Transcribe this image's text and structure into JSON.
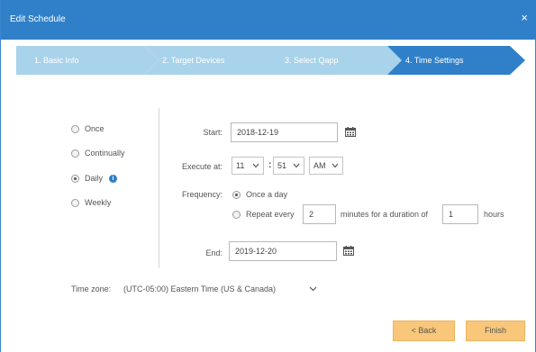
{
  "dialog": {
    "title": "Edit Schedule",
    "close_glyph": "×"
  },
  "steps": [
    {
      "label": "1. Basic Info",
      "state": "completed"
    },
    {
      "label": "2. Target Devices",
      "state": "completed"
    },
    {
      "label": "3. Select Qapp",
      "state": "completed"
    },
    {
      "label": "4. Time Settings",
      "state": "active"
    }
  ],
  "schedule_types": [
    {
      "label": "Once",
      "checked": false
    },
    {
      "label": "Continually",
      "checked": false
    },
    {
      "label": "Daily",
      "checked": true,
      "info": "i"
    },
    {
      "label": "Weekly",
      "checked": false
    }
  ],
  "start": {
    "label": "Start:",
    "value": "2018-12-19"
  },
  "execute_at": {
    "label": "Execute at:",
    "hour": "11",
    "minute": "51",
    "separator": ":",
    "ampm": "AM"
  },
  "frequency": {
    "label": "Frequency:",
    "once_a_day": "Once a day",
    "repeat_every": "Repeat every",
    "repeat_minutes": "2",
    "minutes_text": "minutes for a duration of",
    "duration": "1",
    "hours_text": "hours",
    "selected": "once_a_day"
  },
  "end": {
    "label": "End:",
    "value": "2019-12-20"
  },
  "timezone": {
    "label": "Time zone:",
    "value": "(UTC-05:00) Eastern Time (US & Canada)"
  },
  "buttons": {
    "back": "< Back",
    "finish": "Finish"
  },
  "colors": {
    "titlebar": "#2f80c9",
    "step_completed": "#a9d3ea",
    "step_active": "#2f80c9",
    "button": "#f8c77a"
  }
}
